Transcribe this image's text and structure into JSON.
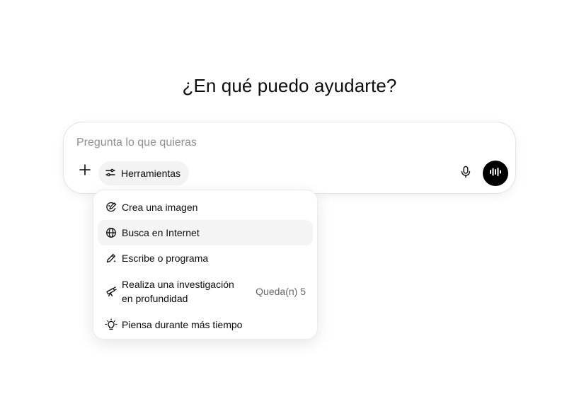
{
  "heading": "¿En qué puedo ayudarte?",
  "composer": {
    "placeholder": "Pregunta lo que quieras",
    "value": "",
    "tools_label": "Herramientas"
  },
  "menu": {
    "items": [
      {
        "label": "Crea una imagen",
        "icon": "image-edit-icon"
      },
      {
        "label": "Busca en Internet",
        "icon": "globe-icon",
        "highlighted": true
      },
      {
        "label": "Escribe o programa",
        "icon": "pen-icon"
      },
      {
        "label": "Realiza una investigación en profundidad",
        "icon": "telescope-icon",
        "quota": "Queda(n) 5"
      },
      {
        "label": "Piensa durante más tiempo",
        "icon": "lightbulb-icon"
      }
    ]
  },
  "colors": {
    "text": "#0d0d0d",
    "placeholder": "#8f8f8f",
    "pill_bg": "#f3f3f3",
    "highlight_bg": "#f4f4f4",
    "voice_button": "#000000"
  }
}
